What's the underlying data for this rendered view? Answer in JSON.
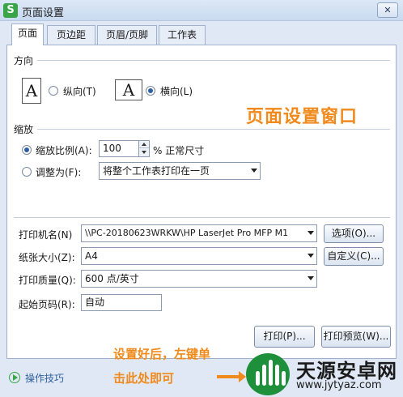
{
  "window": {
    "app_icon": "S",
    "title": "页面设置",
    "close_label": "✕"
  },
  "tabs": [
    {
      "label": "页面",
      "active": true
    },
    {
      "label": "页边距",
      "active": false
    },
    {
      "label": "页眉/页脚",
      "active": false
    },
    {
      "label": "工作表",
      "active": false
    }
  ],
  "orientation": {
    "group_label": "方向",
    "icon_glyph": "A",
    "portrait_label": "纵向(T)",
    "landscape_label": "横向(L)",
    "selected": "landscape"
  },
  "scaling": {
    "group_label": "缩放",
    "scale_label": "缩放比例(A):",
    "scale_value": "100",
    "scale_suffix": "% 正常尺寸",
    "fit_label": "调整为(F):",
    "fit_option": "将整个工作表打印在一页",
    "selected": "scale"
  },
  "printer": {
    "name_label": "打印机名(N)",
    "name_value": "\\\\PC-20180623WRKW\\HP LaserJet Pro MFP M1",
    "options_button": "选项(O)...",
    "paper_label": "纸张大小(Z):",
    "paper_value": "A4",
    "custom_button": "自定义(C)...",
    "quality_label": "打印质量(Q):",
    "quality_value": "600 点/英寸",
    "start_page_label": "起始页码(R):",
    "start_page_value": "自动"
  },
  "actions": {
    "print_button": "打印(P)...",
    "preview_button": "打印预览(W)..."
  },
  "footer": {
    "tips_label": "操作技巧"
  },
  "annotations": {
    "title": "页面设置窗口",
    "tip_line1": "设置好后，左键单",
    "tip_line2": "击此处即可",
    "color": "#f08a1c"
  },
  "watermark": {
    "name": "天源安卓网",
    "url": "www.jytyaz.com"
  }
}
